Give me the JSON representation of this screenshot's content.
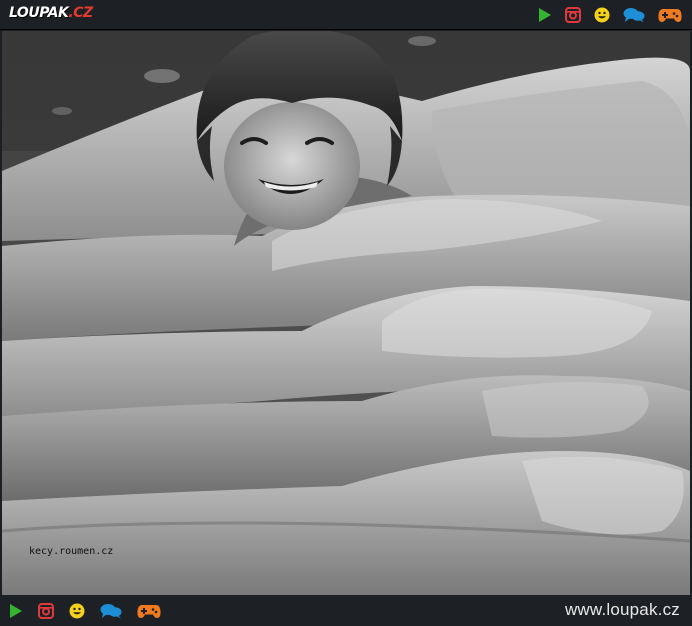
{
  "header": {
    "logo": {
      "main": "LOUPAK",
      "dot": ".",
      "tld": "CZ"
    },
    "icons": [
      {
        "name": "play-icon",
        "color": "#35b431"
      },
      {
        "name": "instagram-icon",
        "color": "#e0393e"
      },
      {
        "name": "smiley-icon",
        "color": "#f4d11a"
      },
      {
        "name": "chat-icon",
        "color": "#1e8fd6"
      },
      {
        "name": "gamepad-icon",
        "color": "#f07a1e"
      }
    ]
  },
  "photo": {
    "watermark": "kecy.roumen.cz"
  },
  "footer": {
    "site_url": "www.loupak.cz",
    "icons": [
      {
        "name": "play-icon",
        "color": "#35b431"
      },
      {
        "name": "instagram-icon",
        "color": "#e0393e"
      },
      {
        "name": "smiley-icon",
        "color": "#f4d11a"
      },
      {
        "name": "chat-icon",
        "color": "#1e8fd6"
      },
      {
        "name": "gamepad-icon",
        "color": "#f07a1e"
      }
    ]
  }
}
